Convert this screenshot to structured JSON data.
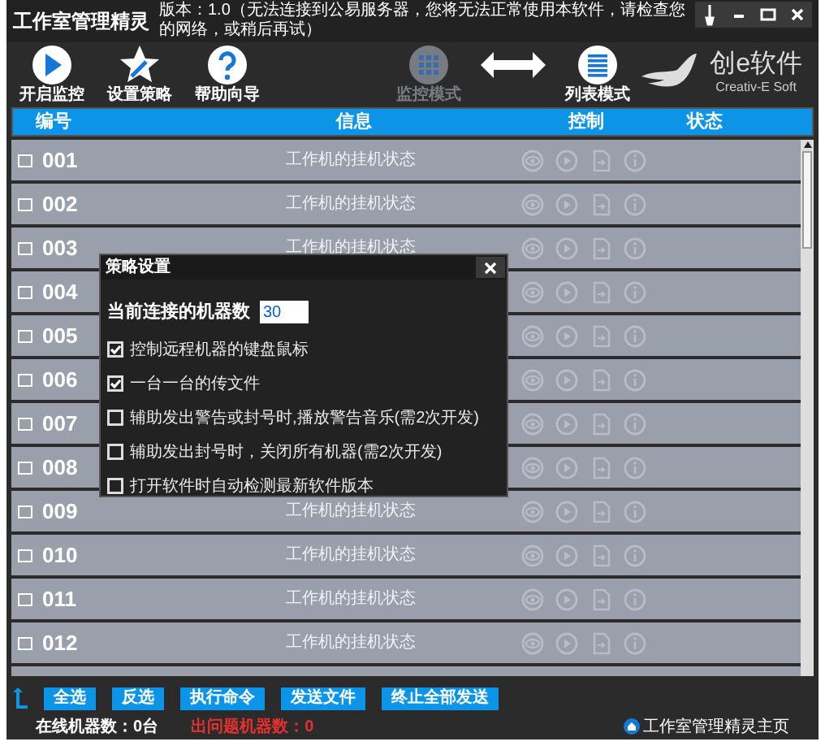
{
  "window": {
    "title": "工作室管理精灵",
    "version_notice": "版本：1.0（无法连接到公易服务器，您将无法正常使用本软件，请检查您的网络，或稍后再试）"
  },
  "toolbar": [
    {
      "label": "开启监控",
      "kind": "play",
      "disabled": false
    },
    {
      "label": "设置策略",
      "kind": "star",
      "disabled": false
    },
    {
      "label": "帮助向导",
      "kind": "help",
      "disabled": false
    },
    {
      "label": "监控模式",
      "kind": "grid",
      "disabled": true
    },
    {
      "label": "列表模式",
      "kind": "list",
      "disabled": false
    }
  ],
  "logo": {
    "name": "创e软件",
    "tagline": "Creativ-E Soft"
  },
  "table": {
    "columns": [
      "编号",
      "信息",
      "控制",
      "状态"
    ],
    "rows": [
      {
        "id": "001",
        "info": "工作机的挂机状态",
        "checked": false
      },
      {
        "id": "002",
        "info": "工作机的挂机状态",
        "checked": false
      },
      {
        "id": "003",
        "info": "工作机的挂机状态",
        "checked": false
      },
      {
        "id": "004",
        "checked": false
      },
      {
        "id": "005",
        "checked": false
      },
      {
        "id": "006",
        "checked": false
      },
      {
        "id": "007",
        "checked": false
      },
      {
        "id": "008",
        "checked": false
      },
      {
        "id": "009",
        "info": "工作机的挂机状态",
        "checked": false
      },
      {
        "id": "010",
        "info": "工作机的挂机状态",
        "checked": false
      },
      {
        "id": "011",
        "info": "工作机的挂机状态",
        "checked": false
      },
      {
        "id": "012",
        "info": "工作机的挂机状态",
        "checked": false
      }
    ]
  },
  "dialog": {
    "title": "策略设置",
    "field_label": "当前连接的机器数",
    "field_value": "30",
    "options": [
      {
        "label": "控制远程机器的键盘鼠标",
        "checked": true
      },
      {
        "label": "一台一台的传文件",
        "checked": true
      },
      {
        "label": "辅助发出警告或封号时,播放警告音乐(需2次开发)",
        "checked": false
      },
      {
        "label": "辅助发出封号时，关闭所有机器(需2次开发)",
        "checked": false
      },
      {
        "label": "打开软件时自动检测最新软件版本",
        "checked": false
      }
    ]
  },
  "footer": {
    "buttons": [
      "全选",
      "反选",
      "执行命令",
      "发送文件",
      "终止全部发送"
    ],
    "online": "在线机器数：0台",
    "problem": "出问题机器数：0",
    "home_link": "工作室管理精灵主页"
  }
}
